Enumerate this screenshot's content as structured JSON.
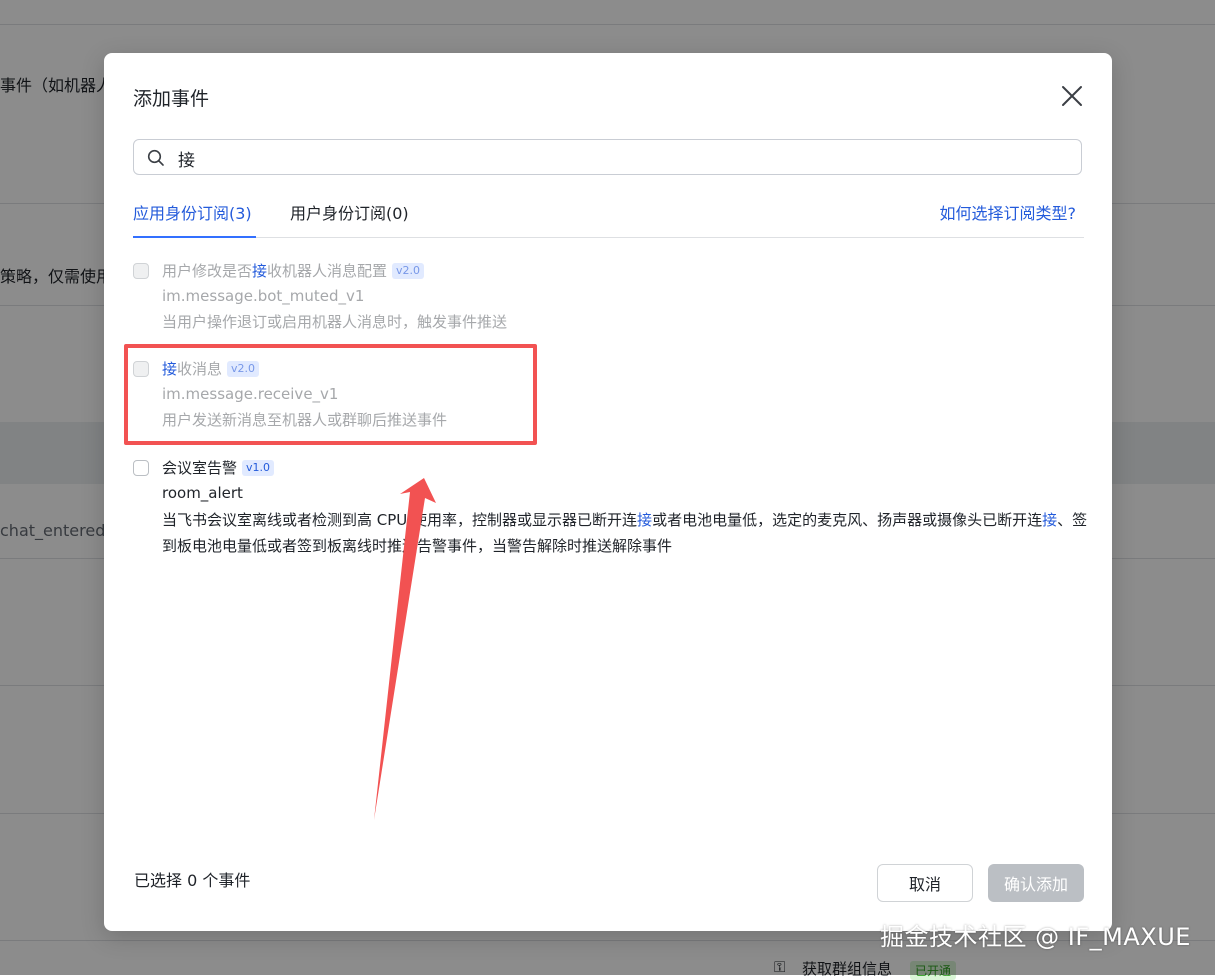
{
  "background": {
    "fragment_1": "事件（如机器人",
    "fragment_2": "策略，仅需使用",
    "fragment_3": "chat_entered_v",
    "fragment_4": "获取群组信息",
    "badge_enabled": "已开通"
  },
  "modal": {
    "title": "添加事件",
    "search": {
      "value": "接",
      "placeholder": ""
    },
    "tabs": [
      {
        "label": "应用身份订阅(3)",
        "active": true
      },
      {
        "label": "用户身份订阅(0)",
        "active": false
      }
    ],
    "help_link": "如何选择订阅类型?",
    "events": [
      {
        "title_pre": "用户修改是否",
        "title_hl": "接",
        "title_post": "收机器人消息配置",
        "version": "v2.0",
        "code": "im.message.bot_muted_v1",
        "desc": "当用户操作退订或启用机器人消息时，触发事件推送",
        "disabled": true
      },
      {
        "title_pre": "",
        "title_hl": "接",
        "title_post": "收消息",
        "version": "v2.0",
        "code": "im.message.receive_v1",
        "desc": "用户发送新消息至机器人或群聊后推送事件",
        "disabled": true,
        "highlighted_annotation": true
      },
      {
        "title": "会议室告警",
        "version": "v1.0",
        "code": "room_alert",
        "desc_1": "当飞书会议室离线或者检测到高 CPU 使用率，控制器或显示器已断开连",
        "desc_hl_1": "接",
        "desc_2": "或者电池电量低，选定的麦克风、扬声器或摄像头已断开连",
        "desc_hl_2": "接",
        "desc_3": "、签到板电池电量低或者签到板离线时推送告警事件，当警告解除时推送解除事件",
        "disabled": false
      }
    ],
    "footer": {
      "selected_count": "已选择 0 个事件",
      "cancel_label": "取消",
      "confirm_label": "确认添加"
    }
  },
  "watermark": "掘金技术社区 @ IF_MAXUE",
  "colors": {
    "accent": "#245bdb",
    "annotation_red": "#f25252",
    "disabled_text": "#a6a8ab",
    "confirm_disabled_bg": "#bbbfc4"
  }
}
